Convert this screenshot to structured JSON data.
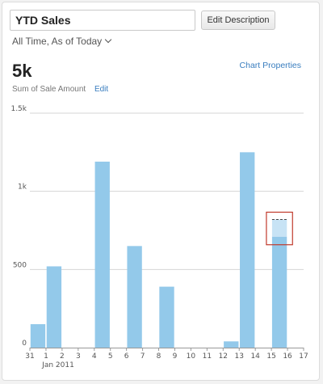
{
  "header": {
    "title": "YTD Sales",
    "edit_description_label": "Edit Description",
    "period_label": "All Time, As of Today"
  },
  "metric": {
    "value": "5k",
    "caption": "Sum of Sale Amount",
    "edit_label": "Edit"
  },
  "chart_properties_label": "Chart Properties",
  "colors": {
    "bar": "#93c9ea",
    "bar_light": "#c7e3f5",
    "highlight_border": "#c0392b",
    "link": "#3a7ebf"
  },
  "icons": {
    "period_dropdown": "chevron-down-icon"
  },
  "chart_data": {
    "type": "bar",
    "title": "",
    "xlabel": "",
    "ylabel": "",
    "x_ticks": [
      "31",
      "1",
      "2",
      "3",
      "4",
      "5",
      "6",
      "7",
      "8",
      "9",
      "10",
      "11",
      "12",
      "13",
      "14",
      "15",
      "16",
      "17"
    ],
    "x_sublabel": "Jan 2011",
    "x": [
      1,
      2,
      5,
      7,
      9,
      13,
      14,
      16
    ],
    "values": [
      150,
      520,
      1190,
      650,
      390,
      40,
      1250,
      710
    ],
    "projected": {
      "x": 16,
      "value": 820
    },
    "ylim": [
      0,
      1500
    ],
    "y_ticks": [
      0,
      500,
      1000,
      1500
    ],
    "y_tick_labels": [
      "0",
      "500",
      "1k",
      "1.5k"
    ],
    "grid": true
  }
}
